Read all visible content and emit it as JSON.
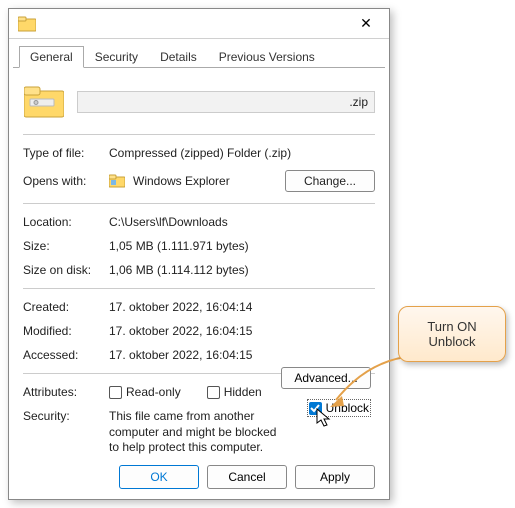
{
  "title": "",
  "close": "✕",
  "tabs": {
    "general": "General",
    "security": "Security",
    "details": "Details",
    "versions": "Previous Versions"
  },
  "file": {
    "name_ext": ".zip"
  },
  "labels": {
    "type": "Type of file:",
    "opens": "Opens with:",
    "location": "Location:",
    "size": "Size:",
    "sizedisk": "Size on disk:",
    "created": "Created:",
    "modified": "Modified:",
    "accessed": "Accessed:",
    "attributes": "Attributes:",
    "securityLbl": "Security:"
  },
  "values": {
    "type": "Compressed (zipped) Folder (.zip)",
    "opens_app": "Windows Explorer",
    "location": "C:\\Users\\lf\\Downloads",
    "size": "1,05 MB (1.111.971 bytes)",
    "sizedisk": "1,06 MB (1.114.112 bytes)",
    "created": "17. oktober 2022, 16:04:14",
    "modified": "17. oktober 2022, 16:04:15",
    "accessed": "17. oktober 2022, 16:04:15"
  },
  "buttons": {
    "change": "Change...",
    "advanced": "Advanced...",
    "ok": "OK",
    "cancel": "Cancel",
    "apply": "Apply"
  },
  "attrs": {
    "readonly": "Read-only",
    "hidden": "Hidden"
  },
  "security_text": "This file came from another computer and might be blocked to help protect this computer.",
  "unblock": "Unblock",
  "callout": "Turn ON\nUnblock"
}
